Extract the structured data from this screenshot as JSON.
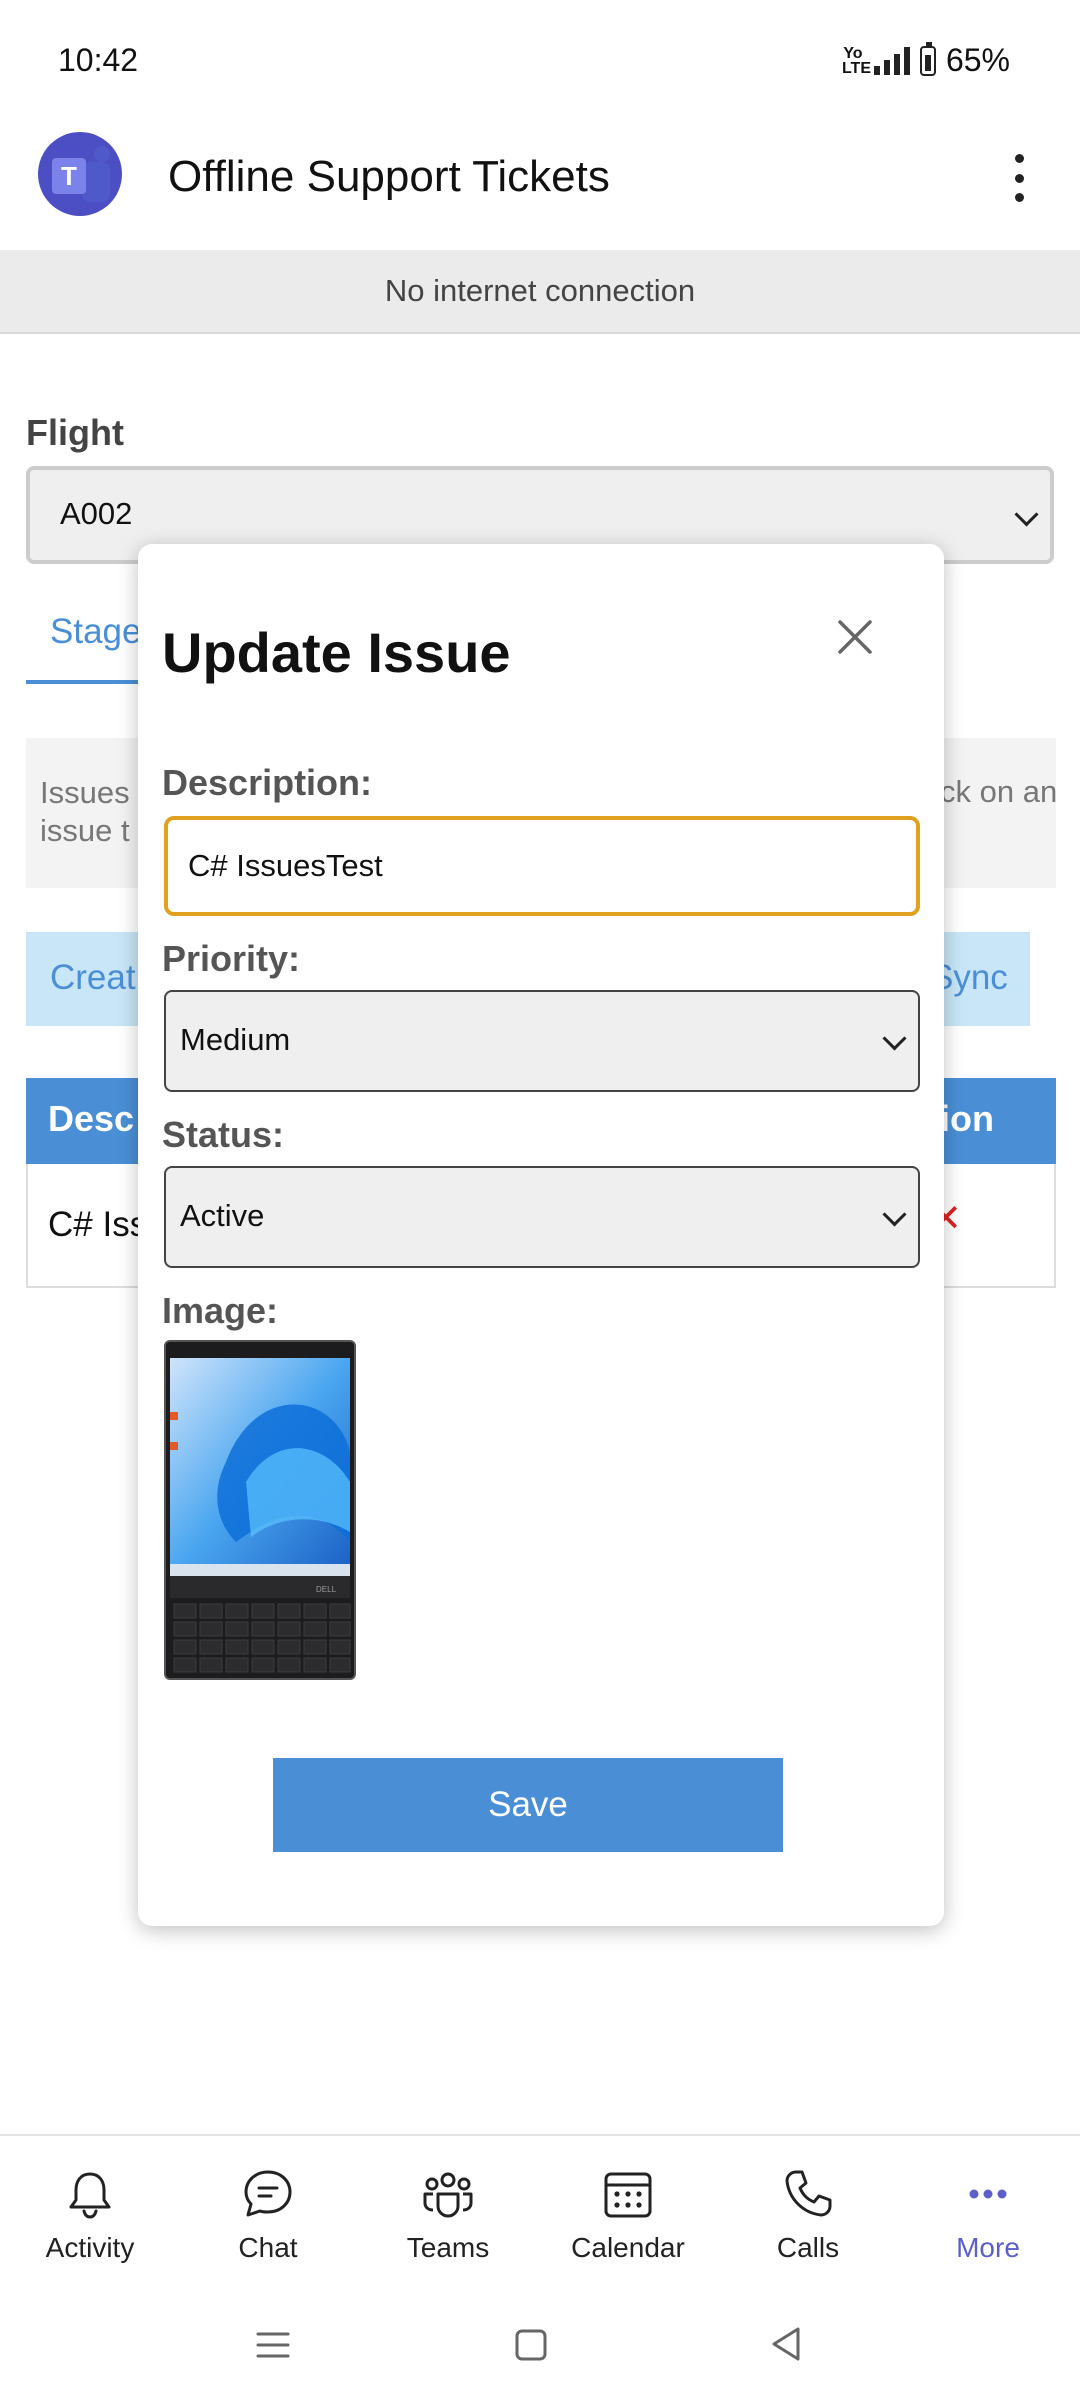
{
  "status_bar": {
    "time": "10:42",
    "volte_top": "Yo",
    "volte_bottom": "LTE",
    "battery": "65%"
  },
  "app": {
    "title": "Offline Support Tickets"
  },
  "banner": {
    "text": "No internet connection"
  },
  "page": {
    "flight_label": "Flight",
    "flight_value": "A002",
    "tab_label": "Stage",
    "info_left_line1": "Issues",
    "info_left_line2": "issue t",
    "info_right": "ck on an",
    "create_label": "Creat",
    "sync_label": "Sync",
    "table_head_desc": "Desc",
    "table_head_action": "ion",
    "row_desc": "C# Iss",
    "row_delete": "✕"
  },
  "modal": {
    "title": "Update Issue",
    "description_label": "Description:",
    "description_value": "C# IssuesTest",
    "priority_label": "Priority:",
    "priority_value": "Medium",
    "status_label": "Status:",
    "status_value": "Active",
    "image_label": "Image:",
    "save_label": "Save",
    "thumb_brand": "DELL"
  },
  "nav": {
    "items": [
      {
        "label": "Activity",
        "icon": "bell-icon",
        "active": false
      },
      {
        "label": "Chat",
        "icon": "chat-icon",
        "active": false
      },
      {
        "label": "Teams",
        "icon": "teams-icon",
        "active": false
      },
      {
        "label": "Calendar",
        "icon": "calendar-icon",
        "active": false
      },
      {
        "label": "Calls",
        "icon": "phone-icon",
        "active": false
      },
      {
        "label": "More",
        "icon": "more-icon",
        "active": true
      }
    ]
  },
  "colors": {
    "accent": "#4a8fd6",
    "teams_purple": "#5b5fc7",
    "focus_border": "#e0a020",
    "banner_bg": "#ebebeb"
  }
}
